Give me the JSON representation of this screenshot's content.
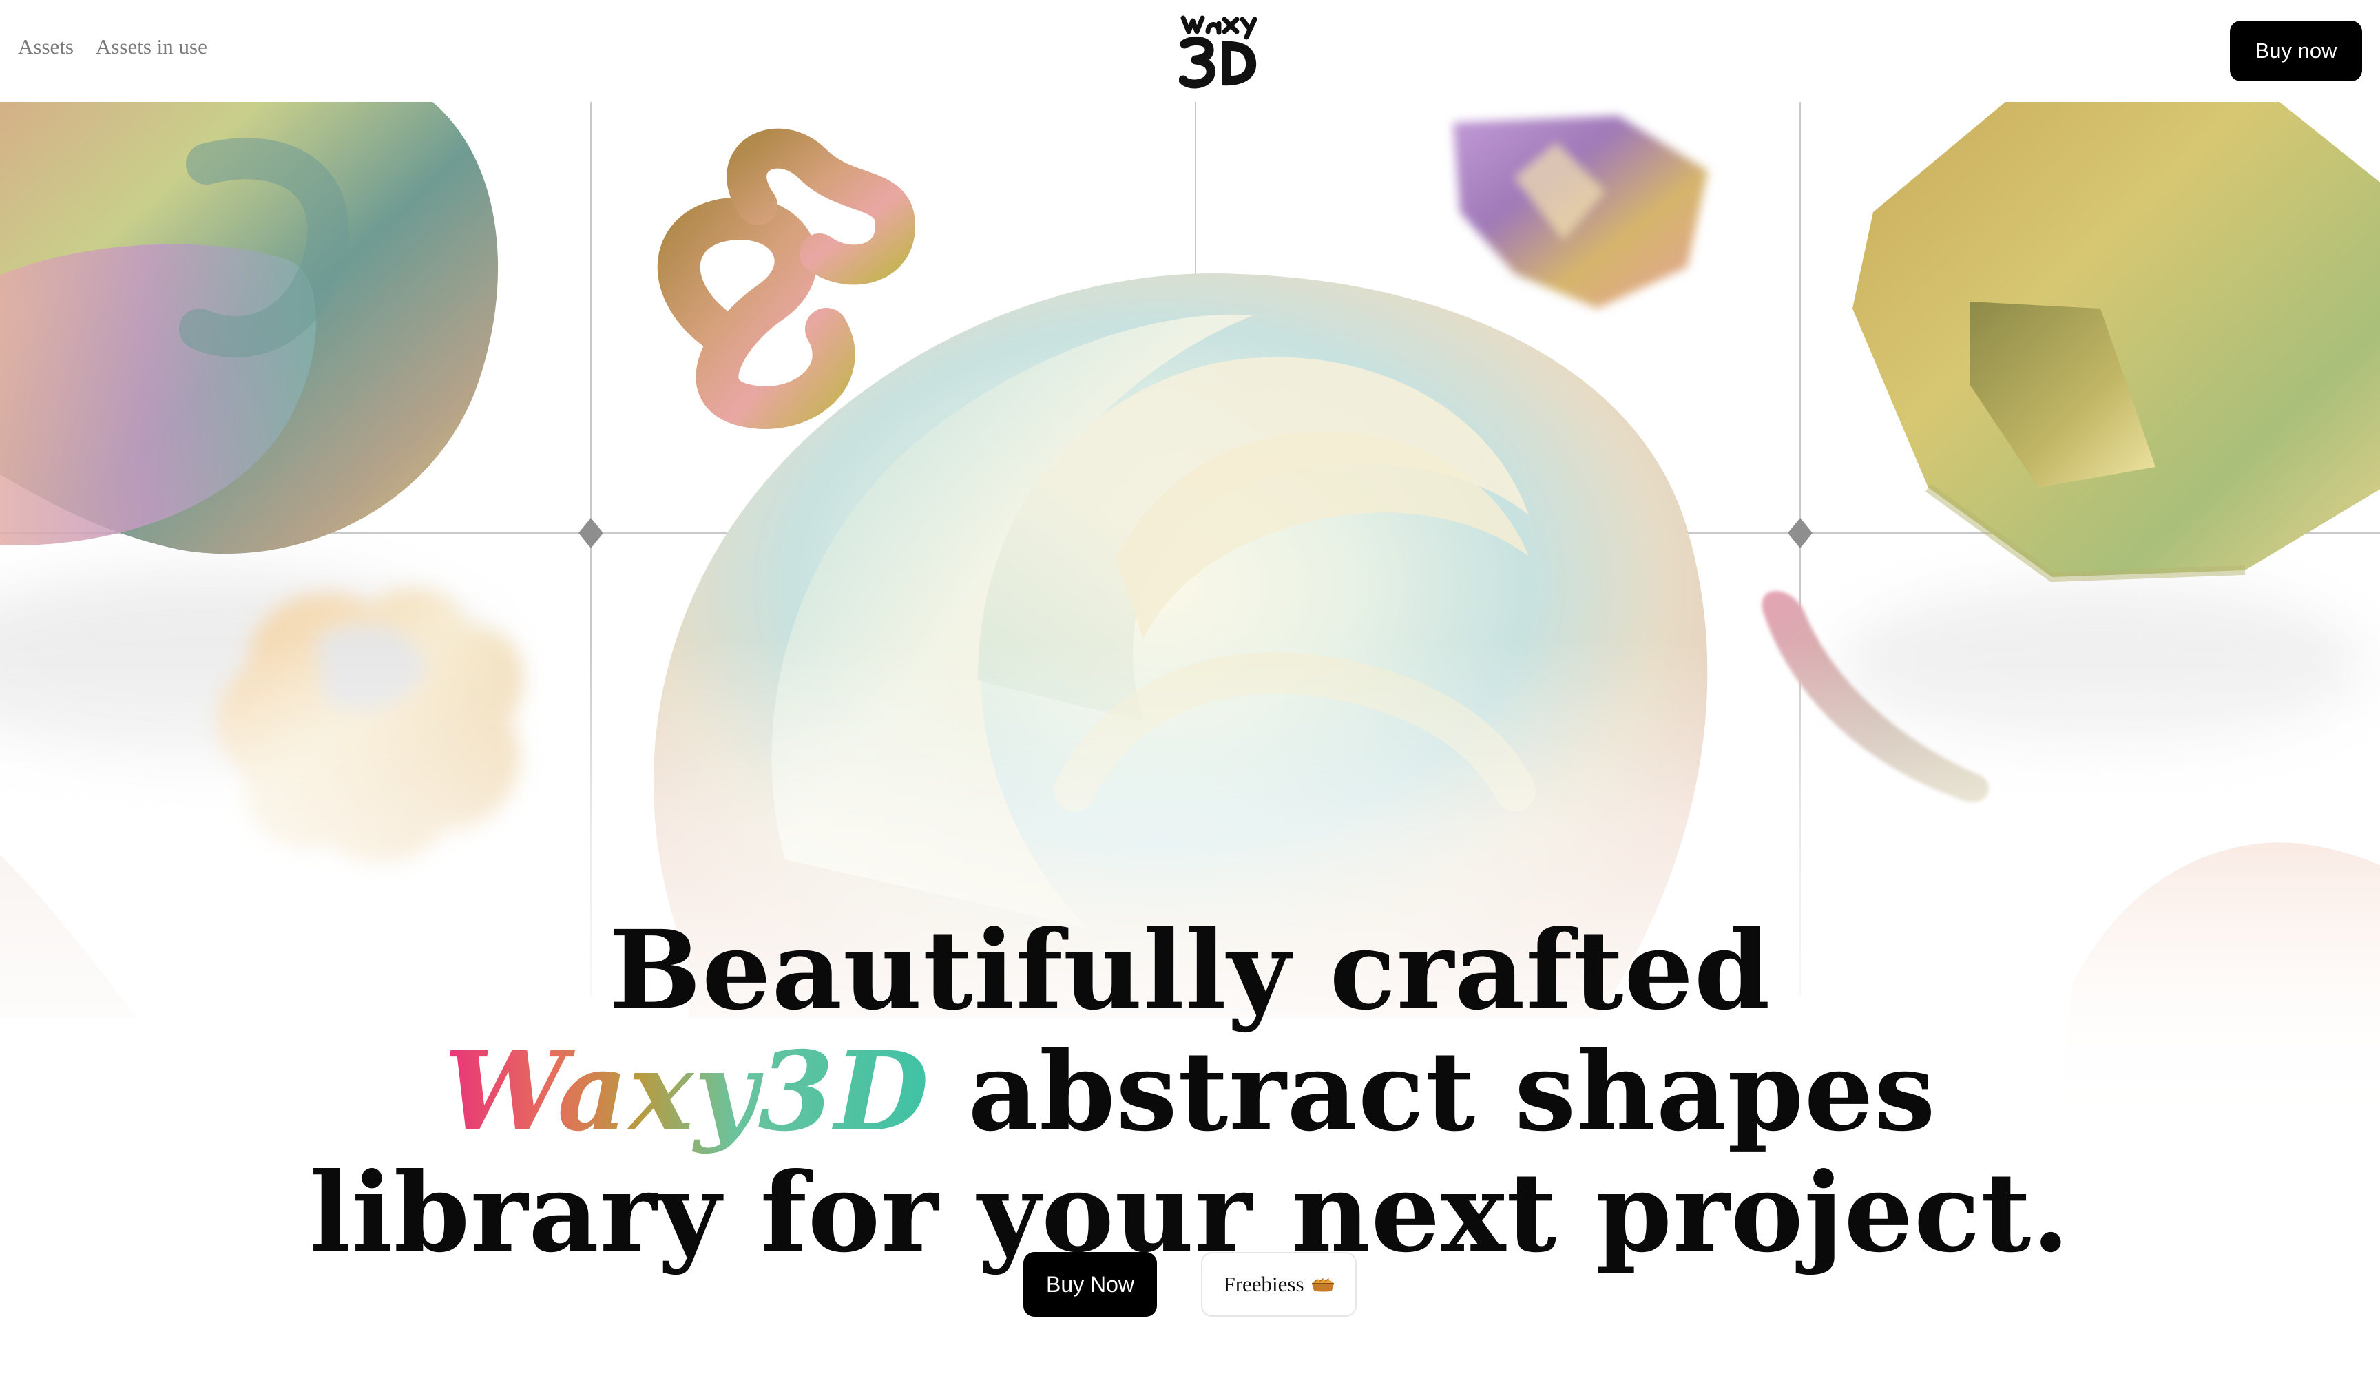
{
  "header": {
    "nav": [
      {
        "label": "Assets"
      },
      {
        "label": "Assets in use"
      }
    ],
    "logo_text": "Waxy 3D",
    "buy_label": "Buy now"
  },
  "hero": {
    "headline_line1": "Beautifully crafted",
    "headline_brand": "Waxy3D",
    "headline_line2_rest": " abstract shapes",
    "headline_line3": "library for your next project.",
    "cta_buy": "Buy Now",
    "cta_freebies": "Freebiess"
  },
  "icons": {
    "freebies": "pie-icon",
    "grid_marker": "diamond-icon"
  },
  "colors": {
    "primary_button": "#000000",
    "brand_gradient_start": "#e8347a",
    "brand_gradient_end": "#3fc2a5",
    "nav_text": "#7a7a7a"
  }
}
